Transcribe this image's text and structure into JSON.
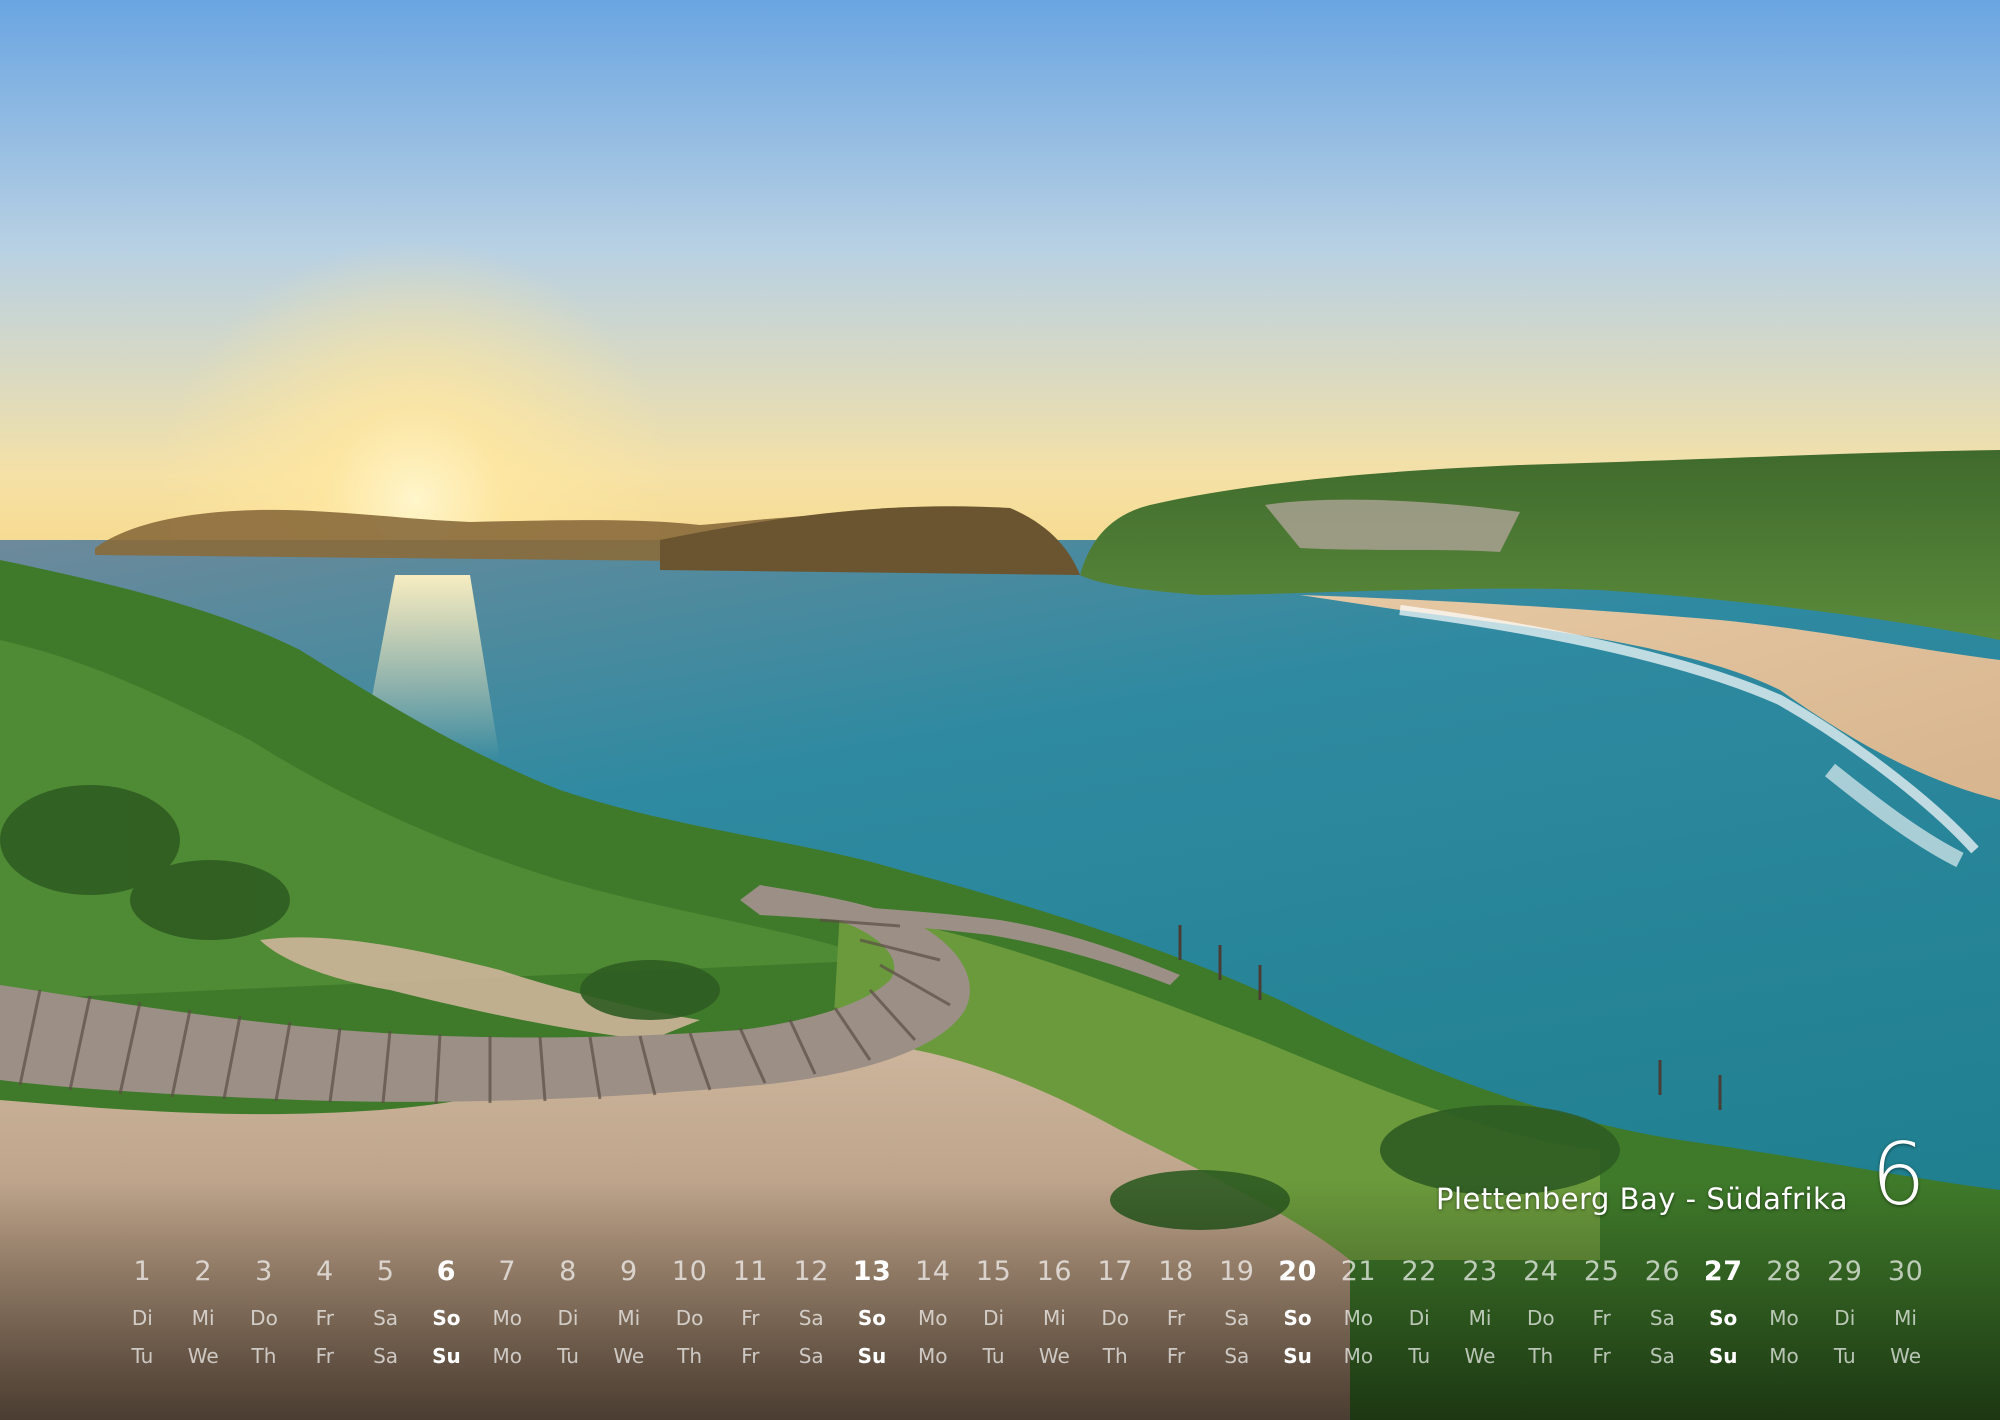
{
  "calendar": {
    "caption": "Plettenberg Bay - Südafrika",
    "month": "6",
    "days": [
      "1",
      "2",
      "3",
      "4",
      "5",
      "6",
      "7",
      "8",
      "9",
      "10",
      "11",
      "12",
      "13",
      "14",
      "15",
      "16",
      "17",
      "18",
      "19",
      "20",
      "21",
      "22",
      "23",
      "24",
      "25",
      "26",
      "27",
      "28",
      "29",
      "30"
    ],
    "weekdays_de": [
      "Di",
      "Mi",
      "Do",
      "Fr",
      "Sa",
      "So",
      "Mo",
      "Di",
      "Mi",
      "Do",
      "Fr",
      "Sa",
      "So",
      "Mo",
      "Di",
      "Mi",
      "Do",
      "Fr",
      "Sa",
      "So",
      "Mo",
      "Di",
      "Mi",
      "Do",
      "Fr",
      "Sa",
      "So",
      "Mo",
      "Di",
      "Mi"
    ],
    "weekdays_en": [
      "Tu",
      "We",
      "Th",
      "Fr",
      "Sa",
      "Su",
      "Mo",
      "Tu",
      "We",
      "Th",
      "Fr",
      "Sa",
      "Su",
      "Mo",
      "Tu",
      "We",
      "Th",
      "Fr",
      "Sa",
      "Su",
      "Mo",
      "Tu",
      "We",
      "Th",
      "Fr",
      "Sa",
      "Su",
      "Mo",
      "Tu",
      "We"
    ],
    "highlighted_days": [
      "6",
      "13",
      "20",
      "27"
    ]
  },
  "palette": {
    "sky_top": "#6aa5e2",
    "sky_horizon": "#f5e1a6",
    "sun": "#fff6cc",
    "sea": "#2f98a6",
    "headland_green": "#3f6a2d",
    "sand": "#b69b83",
    "boardwalk": "#9b8f86",
    "text": "#ffffff"
  }
}
